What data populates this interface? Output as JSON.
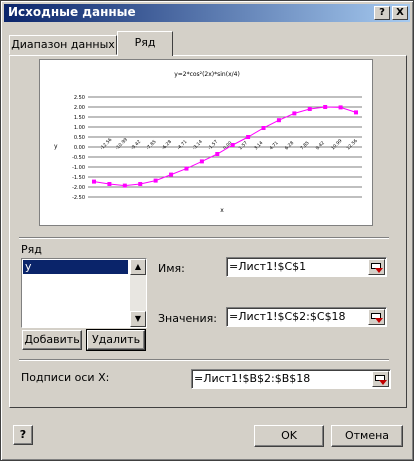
{
  "window": {
    "title": "Исходные данные",
    "help_button": "?",
    "close_button": "X"
  },
  "tabs": [
    {
      "label": "Диапазон данных",
      "active": false
    },
    {
      "label": "Ряд",
      "active": true
    }
  ],
  "chart_data": {
    "type": "line",
    "title": "y=2*cos²(2x)*sin(x/4)",
    "xlabel": "x",
    "ylabel": "y",
    "ylim": [
      -2.5,
      2.5
    ],
    "yticks": [
      "2.50",
      "2.00",
      "1.50",
      "1.00",
      "0.50",
      "0.00",
      "-0.50",
      "-1.00",
      "-1.50",
      "-2.00",
      "-2.50"
    ],
    "categories": [
      "-12.56",
      "-10.99",
      "-9.42",
      "-7.85",
      "-6.28",
      "-4.71",
      "-3.14",
      "-1.57",
      "0.00",
      "1.57",
      "3.14",
      "4.71",
      "6.28",
      "7.85",
      "9.42",
      "10.99",
      "12.56"
    ],
    "series": [
      {
        "values": [
          -1.73,
          -1.85,
          -1.93,
          -1.85,
          -1.68,
          -1.38,
          -1.08,
          -0.72,
          -0.35,
          0.1,
          0.5,
          0.95,
          1.34,
          1.68,
          1.9,
          2.0,
          1.98,
          1.73
        ],
        "color": "#ff00ff"
      }
    ],
    "grid": true
  },
  "series_section": {
    "label": "Ряд",
    "items": [
      "y"
    ],
    "selected": "y",
    "add_button": "Добавить",
    "delete_button": "Удалить"
  },
  "name_field": {
    "label": "Имя:",
    "value": "=Лист1!$C$1"
  },
  "values_field": {
    "label": "Значения:",
    "value": "=Лист1!$C$2:$C$18"
  },
  "x_labels_field": {
    "label": "Подписи оси X:",
    "value": "=Лист1!$B$2:$B$18"
  },
  "footer": {
    "help_icon": "help-question-icon",
    "ok_button": "OK",
    "cancel_button": "Отмена"
  }
}
